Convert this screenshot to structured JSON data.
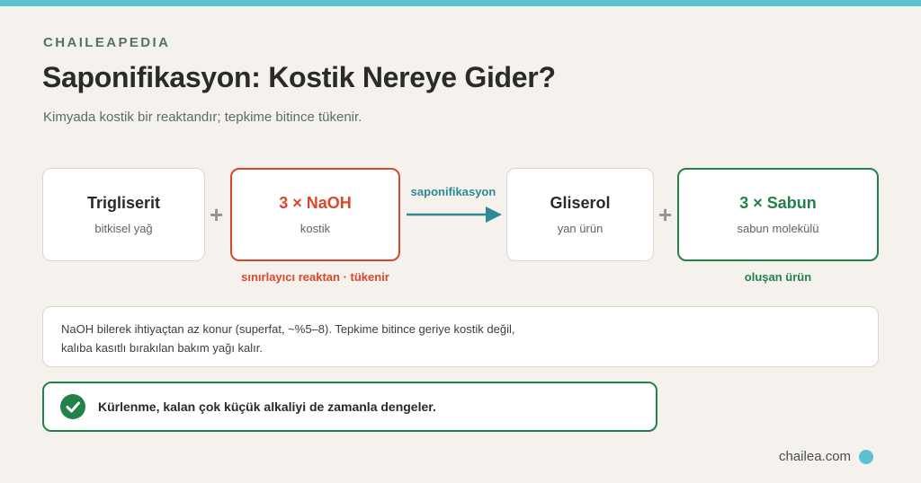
{
  "header": {
    "brand": "CHAILEAPEDIA",
    "title": "Saponifikasyon: Kostik Nereye Gider?",
    "subtitle": "Kimyada kostik bir reaktandır; tepkime bitince tükenir."
  },
  "equation": {
    "reactant1": {
      "name": "Trigliserit",
      "sub": "bitkisel yağ"
    },
    "plus": "+",
    "reactant2": {
      "name": "3 × NaOH",
      "sub": "kostik",
      "caption": "sınırlayıcı reaktan · tükenir",
      "accent": "#d9472b"
    },
    "arrow_label": "saponifikasyon",
    "arrow_color": "#2e8a94",
    "product1": {
      "name": "Gliserol",
      "sub": "yan ürün"
    },
    "product2": {
      "name": "3 × Sabun",
      "sub": "sabun molekülü",
      "caption": "oluşan ürün",
      "accent": "#23814a"
    }
  },
  "note": {
    "line1": "NaOH bilerek ihtiyaçtan az konur (superfat, ~%5–8). Tepkime bitince geriye kostik değil,",
    "line2": "kalıba kasıtlı bırakılan bakım yağı kalır."
  },
  "callout": {
    "icon": "check-circle-icon",
    "text": "Kürlenme, kalan çok küçük alkaliyi de zamanla dengeler."
  },
  "footer": {
    "site": "chailea.com",
    "dot_color": "#5bc2d1"
  }
}
